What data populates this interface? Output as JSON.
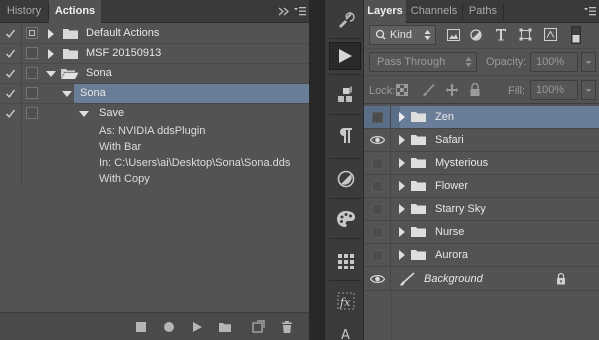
{
  "left_panel": {
    "tabs": [
      {
        "label": "History",
        "active": false
      },
      {
        "label": "Actions",
        "active": true
      }
    ],
    "rows": [
      {
        "label": "Default Actions",
        "checked": true,
        "dialog": true,
        "expanded": false,
        "type": "set"
      },
      {
        "label": "MSF 20150913",
        "checked": true,
        "dialog": false,
        "expanded": false,
        "type": "set"
      },
      {
        "label": "Sona",
        "checked": true,
        "dialog": false,
        "expanded": true,
        "type": "set"
      },
      {
        "label": "Sona",
        "checked": true,
        "dialog": false,
        "expanded": true,
        "type": "action",
        "selected": true
      },
      {
        "label": "Save",
        "checked": true,
        "dialog": false,
        "expanded": true,
        "type": "command"
      }
    ],
    "save_details": [
      "As: NVIDIA ddsPlugin",
      "With Bar",
      "In: C:\\Users\\ai\\Desktop\\Sona\\Sona.dds",
      "With Copy"
    ],
    "bottom_icons": [
      "stop-icon",
      "record-icon",
      "play-icon",
      "new-set-icon",
      "new-action-icon",
      "delete-icon"
    ]
  },
  "mid_toolbar": {
    "icons": [
      "history-brush-icon",
      "actions-play-icon",
      "3d-cube-icon",
      "paragraph-icon",
      "adjustments-icon",
      "styles-palette-icon",
      "swatches-grid-icon",
      "fx-icon",
      "character-icon"
    ]
  },
  "right_panel": {
    "tabs": [
      {
        "label": "Layers",
        "active": true
      },
      {
        "label": "Channels",
        "active": false
      },
      {
        "label": "Paths",
        "active": false
      }
    ],
    "filter_kind": "Kind",
    "blend_mode": "Pass Through",
    "opacity_label": "Opacity:",
    "opacity_value": "100%",
    "lock_label": "Lock:",
    "fill_label": "Fill:",
    "fill_value": "100%",
    "layers": [
      {
        "name": "Zen",
        "visible": false,
        "selected": true,
        "group": true
      },
      {
        "name": "Safari",
        "visible": true,
        "selected": false,
        "group": true
      },
      {
        "name": "Mysterious",
        "visible": false,
        "selected": false,
        "group": true
      },
      {
        "name": "Flower",
        "visible": false,
        "selected": false,
        "group": true
      },
      {
        "name": "Starry Sky",
        "visible": false,
        "selected": false,
        "group": true
      },
      {
        "name": "Nurse",
        "visible": false,
        "selected": false,
        "group": true
      },
      {
        "name": "Aurora",
        "visible": false,
        "selected": false,
        "group": true
      }
    ],
    "background_layer": {
      "name": "Background",
      "visible": true,
      "locked": true
    }
  },
  "colors": {
    "panel_bg": "#535353",
    "selection": "#6a7e99",
    "tab_bar": "#3a3a3a"
  }
}
